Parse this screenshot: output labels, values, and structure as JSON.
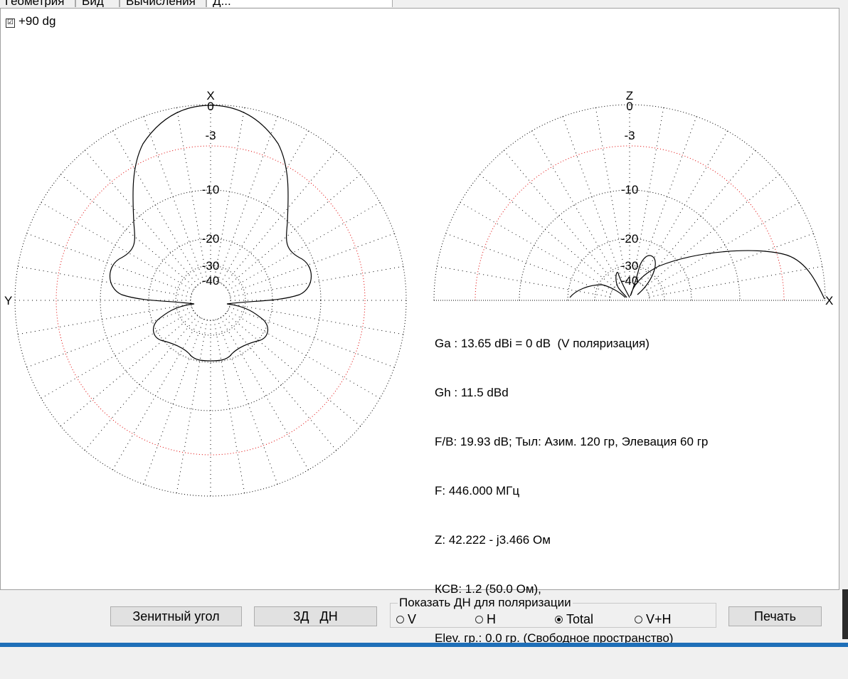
{
  "tabs": [
    {
      "label": "Геометрия",
      "active": false
    },
    {
      "label": "Вид",
      "active": false
    },
    {
      "label": "Вычисления",
      "active": false
    },
    {
      "label": "Д...",
      "active": true
    }
  ],
  "checkbox": {
    "label": "+90 dg",
    "checked": true
  },
  "azimuth_plot": {
    "axis_top_label": "X",
    "axis_left_label": "Y",
    "ring_labels": [
      "0",
      "-3",
      "-10",
      "-20",
      "-30",
      "-40"
    ]
  },
  "elevation_plot": {
    "axis_top_label": "Z",
    "axis_right_label": "X",
    "ring_labels": [
      "0",
      "-3",
      "-10",
      "-20",
      "-30",
      "-40"
    ]
  },
  "info_lines": [
    "Ga : 13.65 dBi = 0 dB  (V поляризация)",
    "Gh : 11.5 dBd",
    "F/B: 19.93 dB; Тыл: Азим. 120 гр, Элевация 60 гр",
    "F: 446.000 МГц",
    "Z: 42.222 - j3.466 Ом",
    "КСВ: 1.2 (50.0 Ом),",
    "Elev. гр.: 0.0 гр. (Свободное пространство)"
  ],
  "buttons": {
    "zenith": "Зенитный угол",
    "three_d": "3Д   ДН",
    "print": "Печать"
  },
  "polarization_group": {
    "title": "Показать ДН для поляризации",
    "options": [
      {
        "label": "V",
        "selected": false
      },
      {
        "label": "H",
        "selected": false
      },
      {
        "label": "Total",
        "selected": true
      },
      {
        "label": "V+H",
        "selected": false
      }
    ]
  },
  "colors": {
    "grid": "#000000",
    "grid_red": "#e00000",
    "pattern": "#000000"
  }
}
